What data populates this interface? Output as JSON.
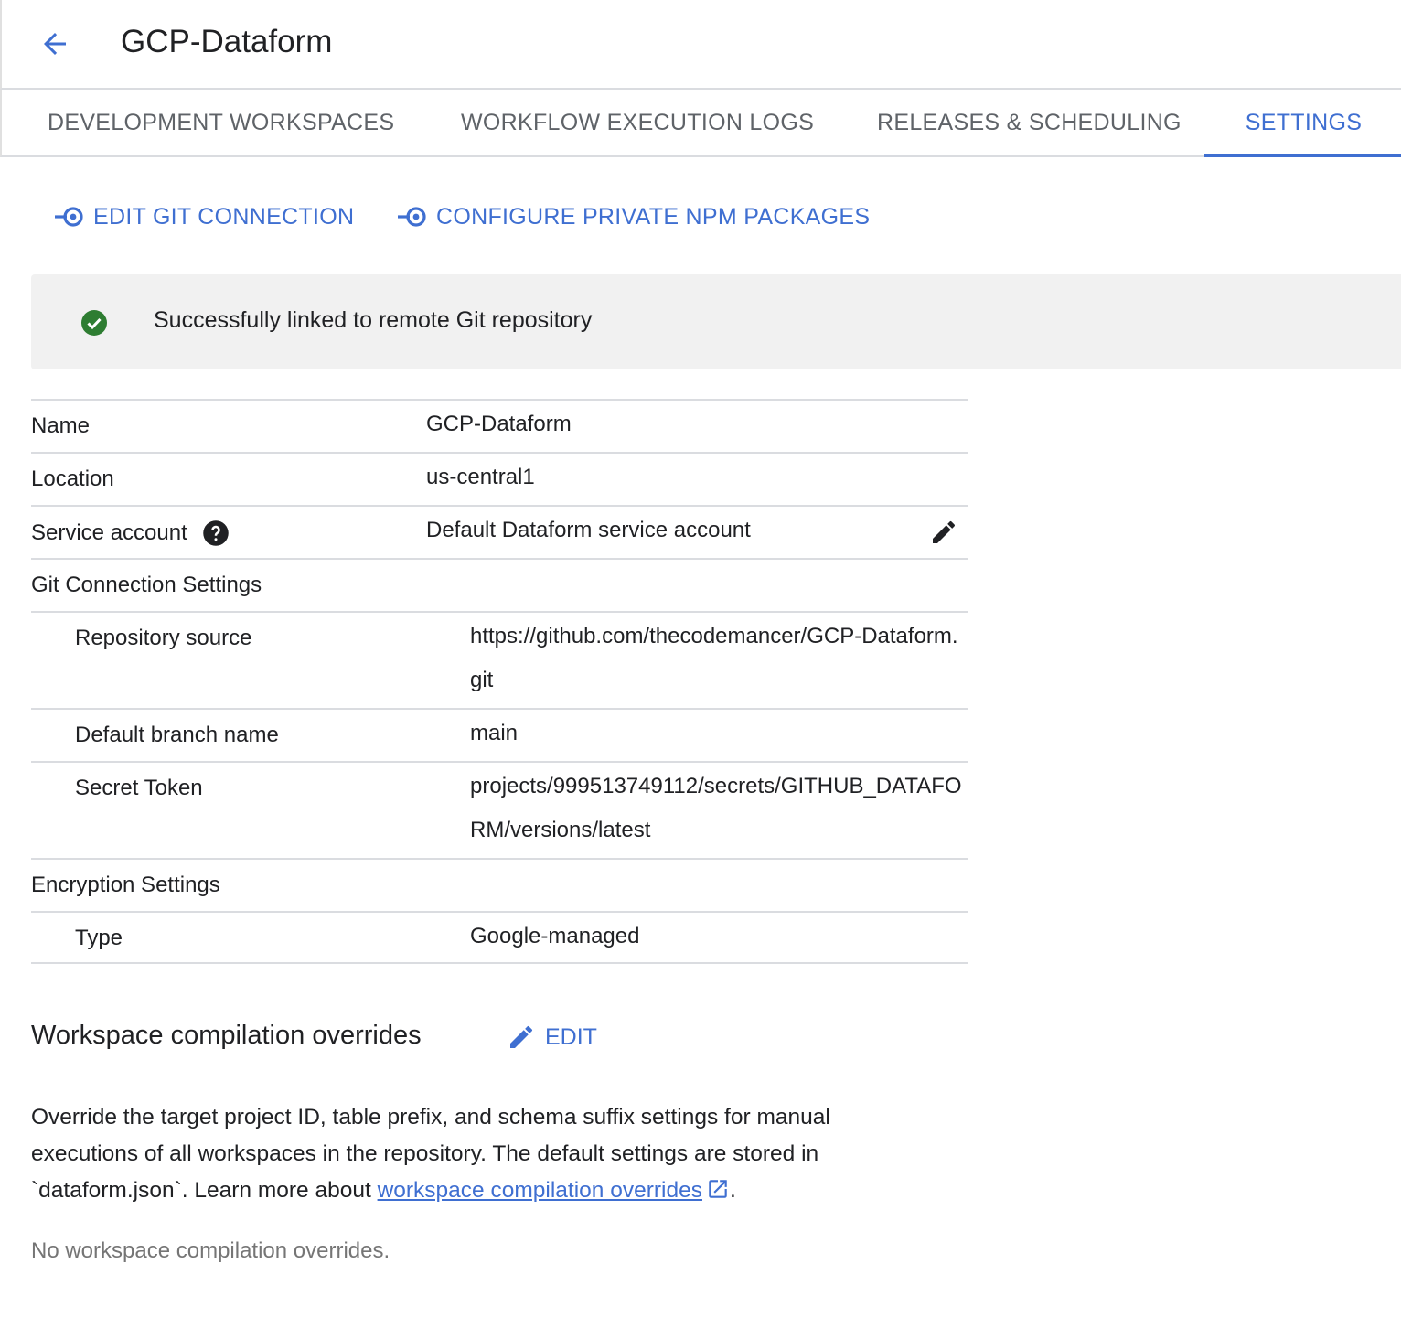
{
  "header": {
    "title": "GCP-Dataform",
    "back_icon": "arrow-back-icon"
  },
  "tabs": [
    {
      "label": "DEVELOPMENT WORKSPACES",
      "active": false
    },
    {
      "label": "WORKFLOW EXECUTION LOGS",
      "active": false
    },
    {
      "label": "RELEASES & SCHEDULING",
      "active": false
    },
    {
      "label": "SETTINGS",
      "active": true
    }
  ],
  "actions": {
    "edit_git": "EDIT GIT CONNECTION",
    "configure_npm": "CONFIGURE PRIVATE NPM PACKAGES",
    "icon": "input-link-icon"
  },
  "banner": {
    "message": "Successfully linked to remote Git repository",
    "icon": "check-circle-icon",
    "icon_color": "#2e7d32"
  },
  "details": {
    "name_label": "Name",
    "name_value": "GCP-Dataform",
    "location_label": "Location",
    "location_value": "us-central1",
    "service_account_label": "Service account",
    "service_account_value": "Default Dataform service account",
    "git_section": "Git Connection Settings",
    "repo_source_label": "Repository source",
    "repo_source_value": "https://github.com/thecodemancer/GCP-Dataform.git",
    "default_branch_label": "Default branch name",
    "default_branch_value": "main",
    "secret_token_label": "Secret Token",
    "secret_token_value": "projects/999513749112/secrets/GITHUB_DATAFORM/versions/latest",
    "encryption_section": "Encryption Settings",
    "type_label": "Type",
    "type_value": "Google-managed"
  },
  "overrides": {
    "heading": "Workspace compilation overrides",
    "edit_label": "EDIT",
    "desc_before": "Override the target project ID, table prefix, and schema suffix settings for manual executions of all workspaces in the repository. The default settings are stored in `dataform.json`. Learn more about ",
    "link_text": "workspace compilation overrides",
    "desc_after": ".",
    "empty_text": "No workspace compilation overrides."
  },
  "colors": {
    "accent": "#3f6fd1",
    "success": "#2e7d32",
    "banner_bg": "#f1f1f1",
    "divider": "#dadce0"
  }
}
